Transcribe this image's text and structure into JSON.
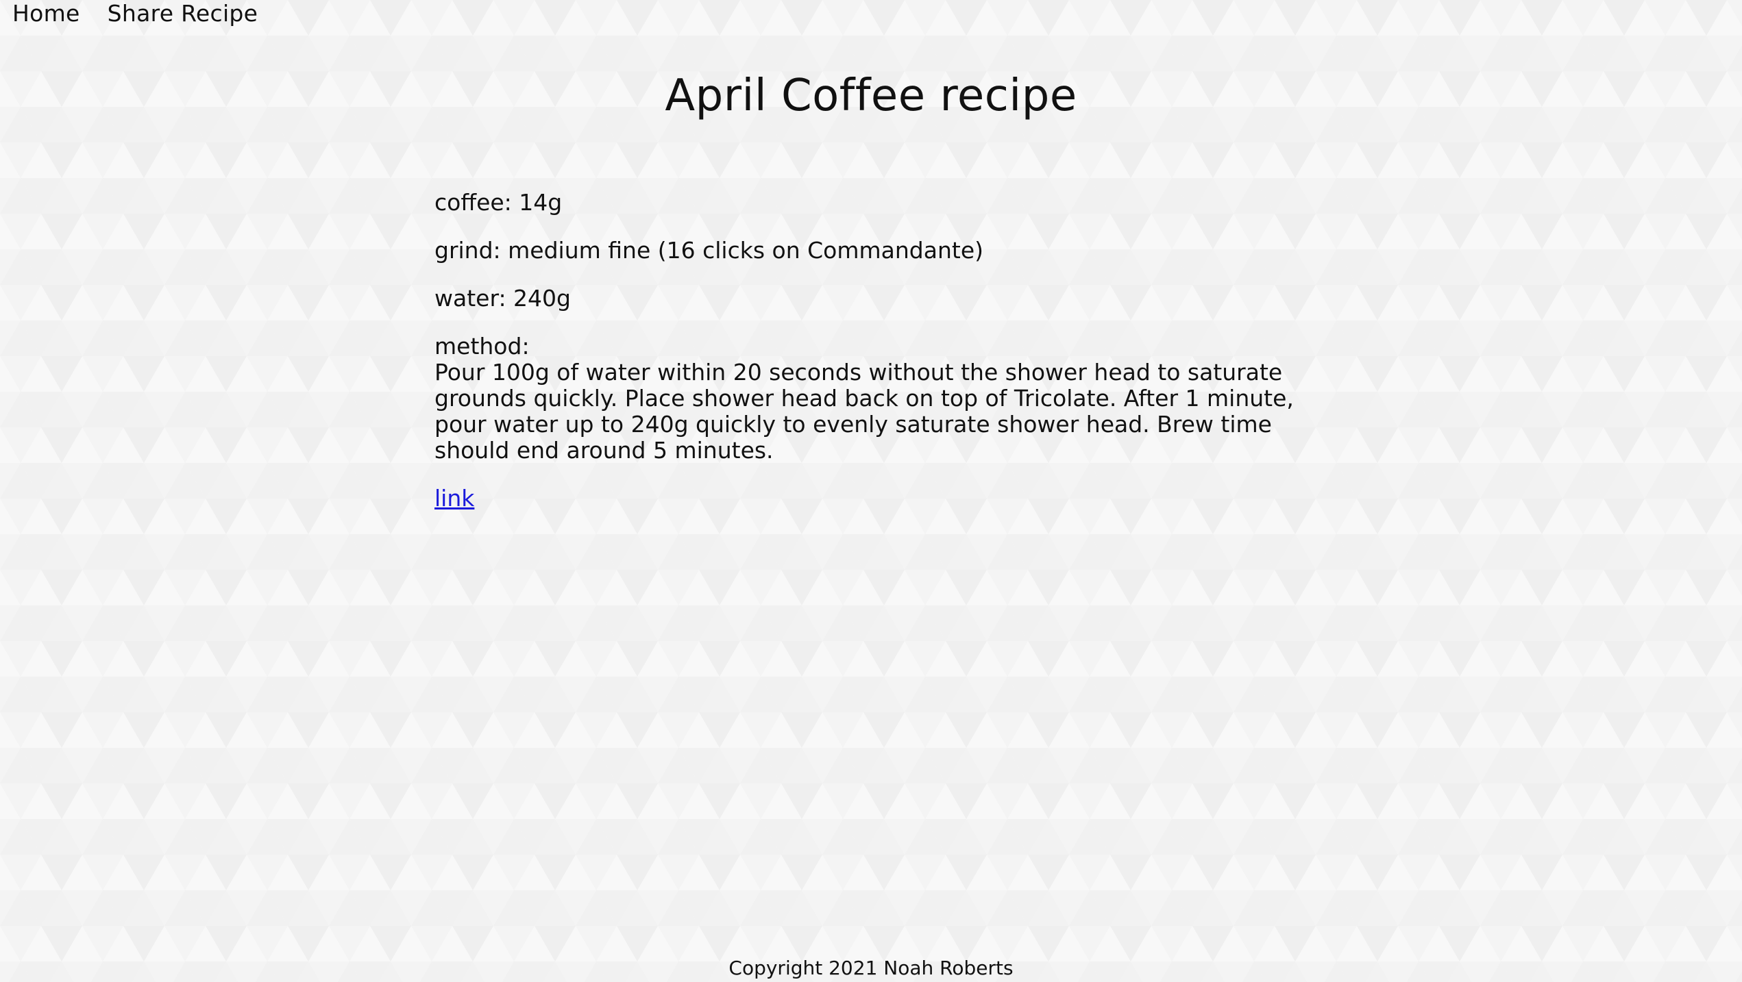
{
  "nav": {
    "home_label": "Home",
    "share_label": "Share Recipe"
  },
  "page": {
    "title": "April Coffee recipe"
  },
  "recipe": {
    "coffee": "coffee: 14g",
    "grind": "grind: medium fine (16 clicks on Commandante)",
    "water": "water: 240g",
    "method_label": "method:",
    "method_text": "Pour 100g of water within 20 seconds without the shower head to saturate grounds quickly. Place shower head back on top of Tricolate. After 1 minute, pour water up to 240g quickly to evenly saturate shower head. Brew time should end around 5 minutes.",
    "link_label": "link"
  },
  "footer": {
    "copyright": "Copyright 2021 Noah Roberts"
  },
  "colors": {
    "background": "#f7f7f7",
    "text": "#111111",
    "link": "#1a1adb",
    "pattern": "#e8e8e8"
  }
}
